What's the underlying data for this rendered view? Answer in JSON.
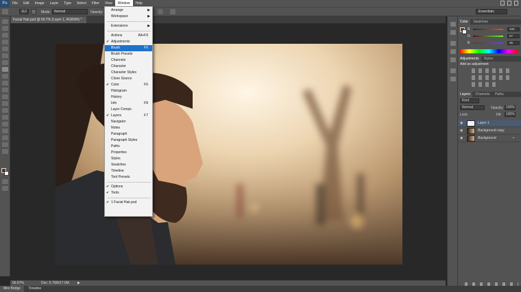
{
  "app": {
    "logo": "Ps"
  },
  "menubar": {
    "items": [
      "File",
      "Edit",
      "Image",
      "Layer",
      "Type",
      "Select",
      "Filter",
      "View",
      "Window",
      "Help"
    ],
    "active": "Window"
  },
  "options": {
    "brush_size": "112",
    "mode_label": "Mode:",
    "mode_value": "Normal",
    "opacity_label": "Opacity:",
    "workspace": "Essentials"
  },
  "document": {
    "tab_title": "Facial Hair.psd @ 66.7% (Layer 1, RGB/8#) *",
    "tab_close": "×"
  },
  "status": {
    "zoom": "66.67%",
    "doc": "Doc: 6.75M/17.0M"
  },
  "bottom_tabs": [
    "Mini Bridge",
    "Timeline"
  ],
  "color_panel": {
    "tabs": [
      "Color",
      "Swatches"
    ],
    "r_label": "R",
    "r_value": "100",
    "g_label": "G",
    "g_value": "67",
    "b_label": "B",
    "b_value": "36"
  },
  "adjustments_panel": {
    "tabs": [
      "Adjustments",
      "Styles"
    ],
    "heading": "Add an adjustment"
  },
  "layers_panel": {
    "tabs": [
      "Layers",
      "Channels",
      "Paths"
    ],
    "kind": "Kind",
    "blend": "Normal",
    "opacity_label": "Opacity:",
    "opacity_value": "100%",
    "lock_label": "Lock:",
    "fill_label": "Fill:",
    "fill_value": "100%",
    "layers": [
      {
        "name": "Layer 1",
        "selected": true
      },
      {
        "name": "Background copy",
        "selected": false
      },
      {
        "name": "Background",
        "selected": false
      }
    ]
  },
  "window_menu": {
    "items": [
      {
        "label": "Arrange",
        "submenu": true
      },
      {
        "label": "Workspace",
        "submenu": true
      },
      {
        "label": "Extensions",
        "submenu": true
      },
      {
        "label": "Actions",
        "shortcut": "Alt+F9"
      },
      {
        "label": "Adjustments",
        "checked": true
      },
      {
        "label": "Brush",
        "shortcut": "F5",
        "highlighted": true
      },
      {
        "label": "Brush Presets"
      },
      {
        "label": "Channels"
      },
      {
        "label": "Character"
      },
      {
        "label": "Character Styles"
      },
      {
        "label": "Clone Source"
      },
      {
        "label": "Color",
        "shortcut": "F6",
        "checked": true
      },
      {
        "label": "Histogram"
      },
      {
        "label": "History"
      },
      {
        "label": "Info",
        "shortcut": "F8"
      },
      {
        "label": "Layer Comps"
      },
      {
        "label": "Layers",
        "shortcut": "F7",
        "checked": true
      },
      {
        "label": "Navigator"
      },
      {
        "label": "Notes"
      },
      {
        "label": "Paragraph"
      },
      {
        "label": "Paragraph Styles"
      },
      {
        "label": "Paths"
      },
      {
        "label": "Properties"
      },
      {
        "label": "Styles"
      },
      {
        "label": "Swatches"
      },
      {
        "label": "Timeline"
      },
      {
        "label": "Tool Presets"
      },
      {
        "label": "Options",
        "checked": true
      },
      {
        "label": "Tools",
        "checked": true
      },
      {
        "label": "1 Facial Hair.psd",
        "checked": true
      }
    ],
    "check_glyph": "✔",
    "arrow_glyph": "▶"
  },
  "colors": {
    "menubar": "#535353",
    "highlight": "#1e72cc",
    "panel": "#535353",
    "canvas_bg": "#282828"
  }
}
